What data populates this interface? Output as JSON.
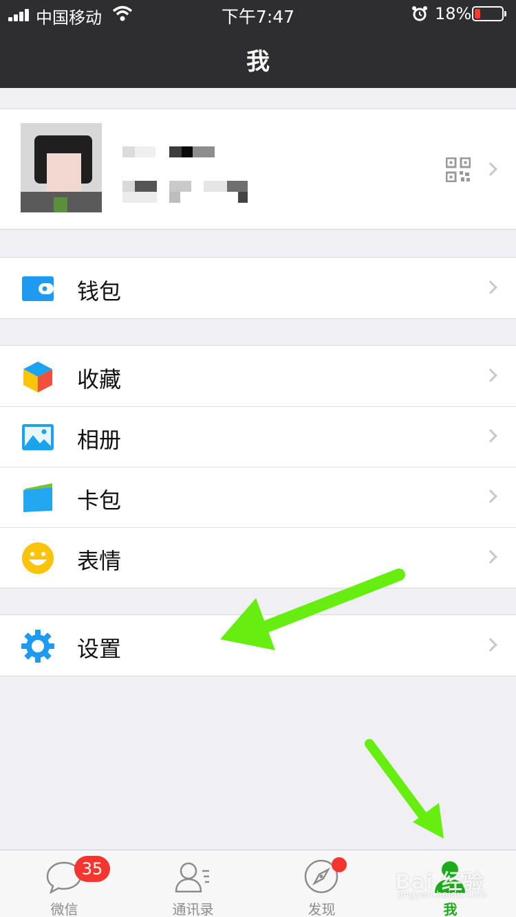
{
  "status": {
    "carrier": "中国移动",
    "time": "下午7:47",
    "battery_pct": "18%"
  },
  "nav": {
    "title": "我"
  },
  "profile": {
    "avatar_icon": "avatar",
    "qr_icon": "qr-code-icon"
  },
  "groups": [
    {
      "items": [
        {
          "label": "钱包",
          "icon": "wallet-icon"
        }
      ]
    },
    {
      "items": [
        {
          "label": "收藏",
          "icon": "favorites-cube-icon"
        },
        {
          "label": "相册",
          "icon": "album-icon"
        },
        {
          "label": "卡包",
          "icon": "card-package-icon"
        },
        {
          "label": "表情",
          "icon": "sticker-smile-icon"
        }
      ]
    },
    {
      "items": [
        {
          "label": "设置",
          "icon": "settings-gear-icon"
        }
      ]
    }
  ],
  "tabbar": {
    "tabs": [
      {
        "label": "微信",
        "icon": "chat-bubble-icon",
        "badge": "35"
      },
      {
        "label": "通讯录",
        "icon": "contacts-icon"
      },
      {
        "label": "发现",
        "icon": "discover-compass-icon"
      },
      {
        "label": "我",
        "icon": "me-person-icon",
        "active": true
      }
    ]
  },
  "colors": {
    "nav_bg": "#2e2e31",
    "page_bg": "#efeff4",
    "accent_green": "#1aad19",
    "badge_red": "#f43530",
    "annotation_arrow": "#66ee11"
  },
  "watermark": {
    "text": "Bai 经验",
    "url": "jingyan.baidu.com"
  }
}
